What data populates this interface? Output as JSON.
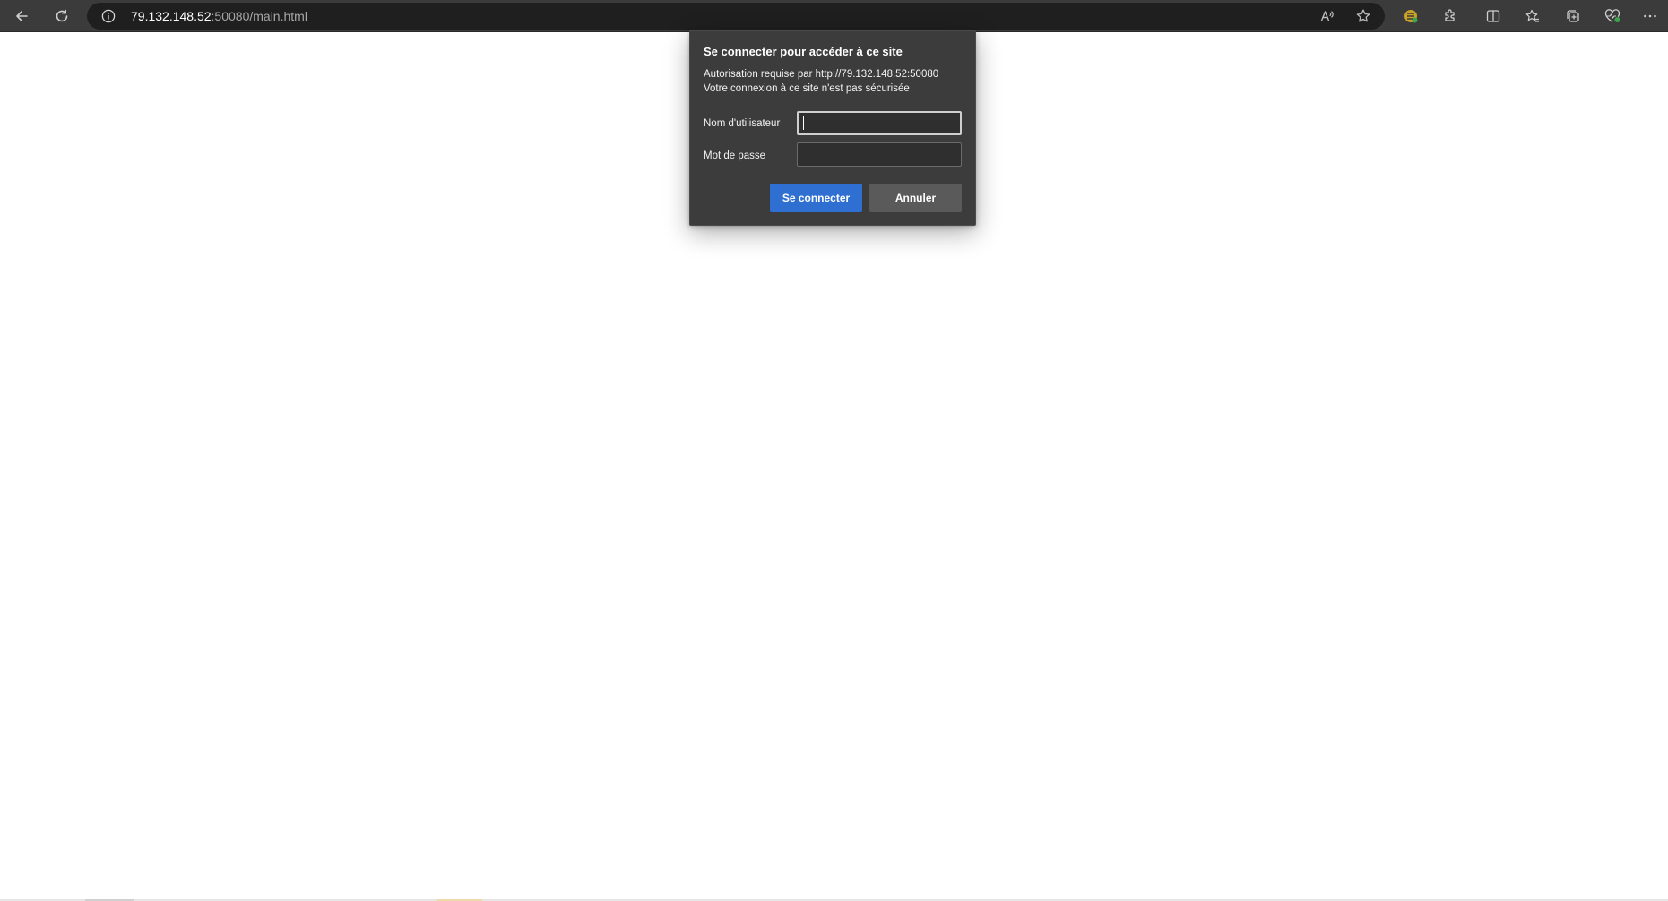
{
  "browser": {
    "url_host": "79.132.148.52",
    "url_rest": ":50080/main.html",
    "icons": {
      "back": "back-arrow-icon",
      "refresh": "refresh-icon",
      "site_info": "info-icon",
      "read_aloud": "read-aloud-icon",
      "favorite": "star-icon",
      "extension_badge": "extension-badge-icon",
      "extensions": "puzzle-icon",
      "split_screen": "split-screen-icon",
      "favorites_bar": "favorites-icon",
      "collections": "collections-icon",
      "health": "browser-essentials-icon",
      "more": "more-icon"
    }
  },
  "dialog": {
    "title": "Se connecter pour accéder à ce site",
    "line1": "Autorisation requise par http://79.132.148.52:50080",
    "line2": "Votre connexion à ce site n'est pas sécurisée",
    "username_label": "Nom d'utilisateur",
    "username_value": "",
    "password_label": "Mot de passe",
    "password_value": "",
    "submit_label": "Se connecter",
    "cancel_label": "Annuler"
  },
  "colors": {
    "toolbar_bg": "#3b3b3b",
    "address_bar_bg": "#1f1f1f",
    "dialog_bg": "#3c3c3c",
    "primary_button": "#2f6fd1",
    "secondary_button": "#5a5a5a"
  }
}
